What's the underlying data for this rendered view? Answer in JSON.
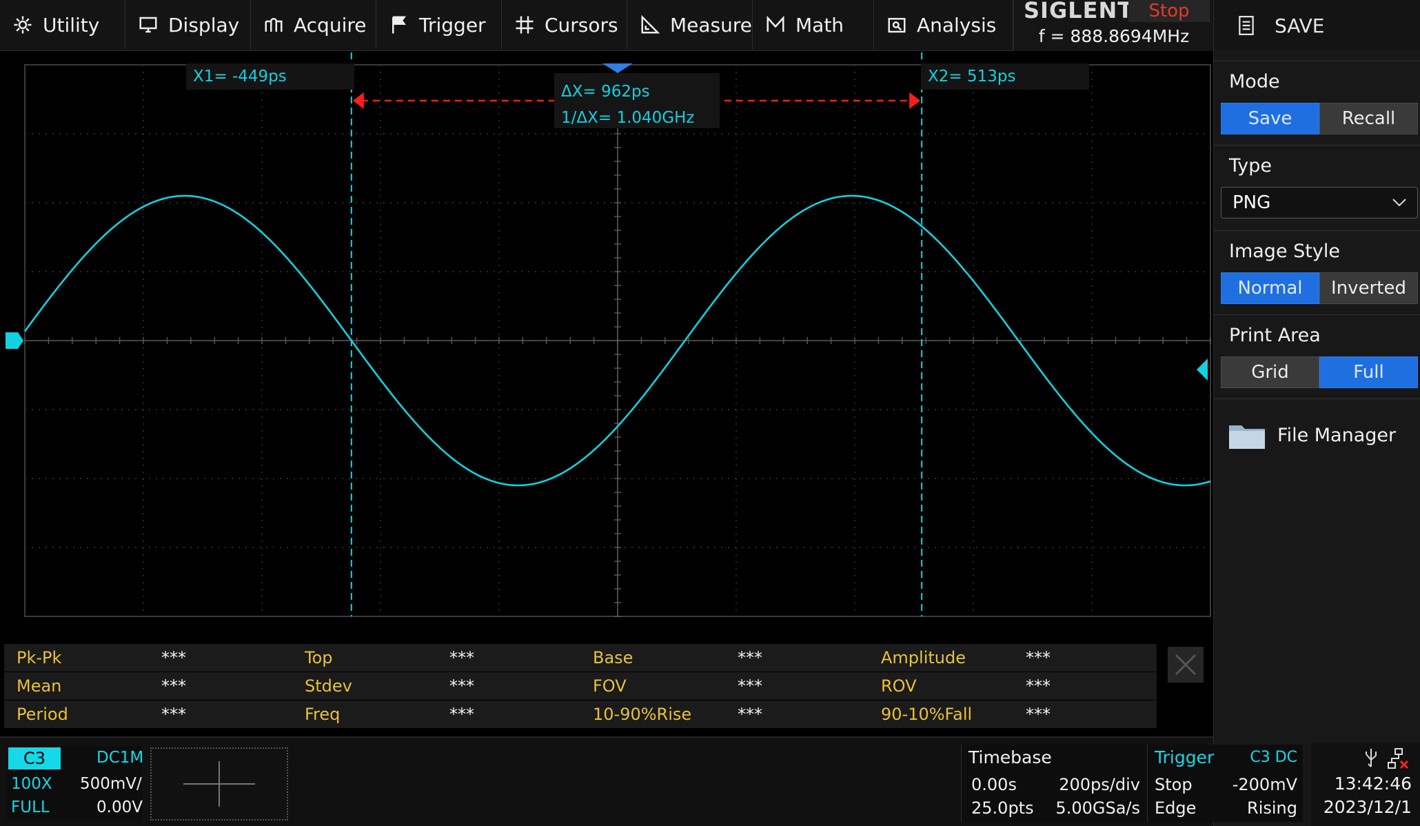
{
  "menu": {
    "utility": "Utility",
    "display": "Display",
    "acquire": "Acquire",
    "trigger": "Trigger",
    "cursors": "Cursors",
    "measure": "Measure",
    "math": "Math",
    "analysis": "Analysis"
  },
  "brand": {
    "logo": "SIGLENT",
    "run_state": "Stop",
    "frequency": "f = 888.8694MHz"
  },
  "right_panel": {
    "title": "SAVE",
    "mode": {
      "label": "Mode",
      "options": [
        "Save",
        "Recall"
      ],
      "selected": "Save"
    },
    "type": {
      "label": "Type",
      "value": "PNG"
    },
    "image_style": {
      "label": "Image Style",
      "options": [
        "Normal",
        "Inverted"
      ],
      "selected": "Normal"
    },
    "print_area": {
      "label": "Print Area",
      "options": [
        "Grid",
        "Full"
      ],
      "selected": "Full"
    },
    "file_manager": "File Manager"
  },
  "cursors": {
    "x1_label": "X1= -449ps",
    "x2_label": "X2= 513ps",
    "delta_x": "ΔX= 962ps",
    "inv_delta_x": "1/ΔX= 1.040GHz",
    "x1_ps": -449,
    "x2_ps": 513
  },
  "waveform": {
    "channel": "C3",
    "color": "#12d2e0",
    "frequency_mhz": 888.8694,
    "timebase_ps_per_div": 200,
    "horizontal_divisions": 10,
    "vertical_divisions": 8,
    "amplitude_div": 2.1,
    "offset_div": 0.0,
    "phase_zero_crossing_ps": -449
  },
  "measurements": [
    [
      {
        "name": "Pk-Pk",
        "value": "***"
      },
      {
        "name": "Top",
        "value": "***"
      },
      {
        "name": "Base",
        "value": "***"
      },
      {
        "name": "Amplitude",
        "value": "***"
      }
    ],
    [
      {
        "name": "Mean",
        "value": "***"
      },
      {
        "name": "Stdev",
        "value": "***"
      },
      {
        "name": "FOV",
        "value": "***"
      },
      {
        "name": "ROV",
        "value": "***"
      }
    ],
    [
      {
        "name": "Period",
        "value": "***"
      },
      {
        "name": "Freq",
        "value": "***"
      },
      {
        "name": "10-90%Rise",
        "value": "***"
      },
      {
        "name": "90-10%Fall",
        "value": "***"
      }
    ]
  ],
  "channel_info": {
    "name": "C3",
    "coupling": "DC1M",
    "probe": "100X",
    "scale": "500mV/",
    "bandwidth": "FULL",
    "offset": "0.00V"
  },
  "timebase": {
    "label": "Timebase",
    "delay": "0.00s",
    "scale": "200ps/div",
    "points": "25.0pts",
    "sample_rate": "5.00GSa/s"
  },
  "trigger": {
    "label": "Trigger",
    "source": "C3 DC",
    "mode": "Stop",
    "level": "-200mV",
    "type": "Edge",
    "slope": "Rising"
  },
  "clock": {
    "time": "13:42:46",
    "date": "2023/12/1"
  }
}
